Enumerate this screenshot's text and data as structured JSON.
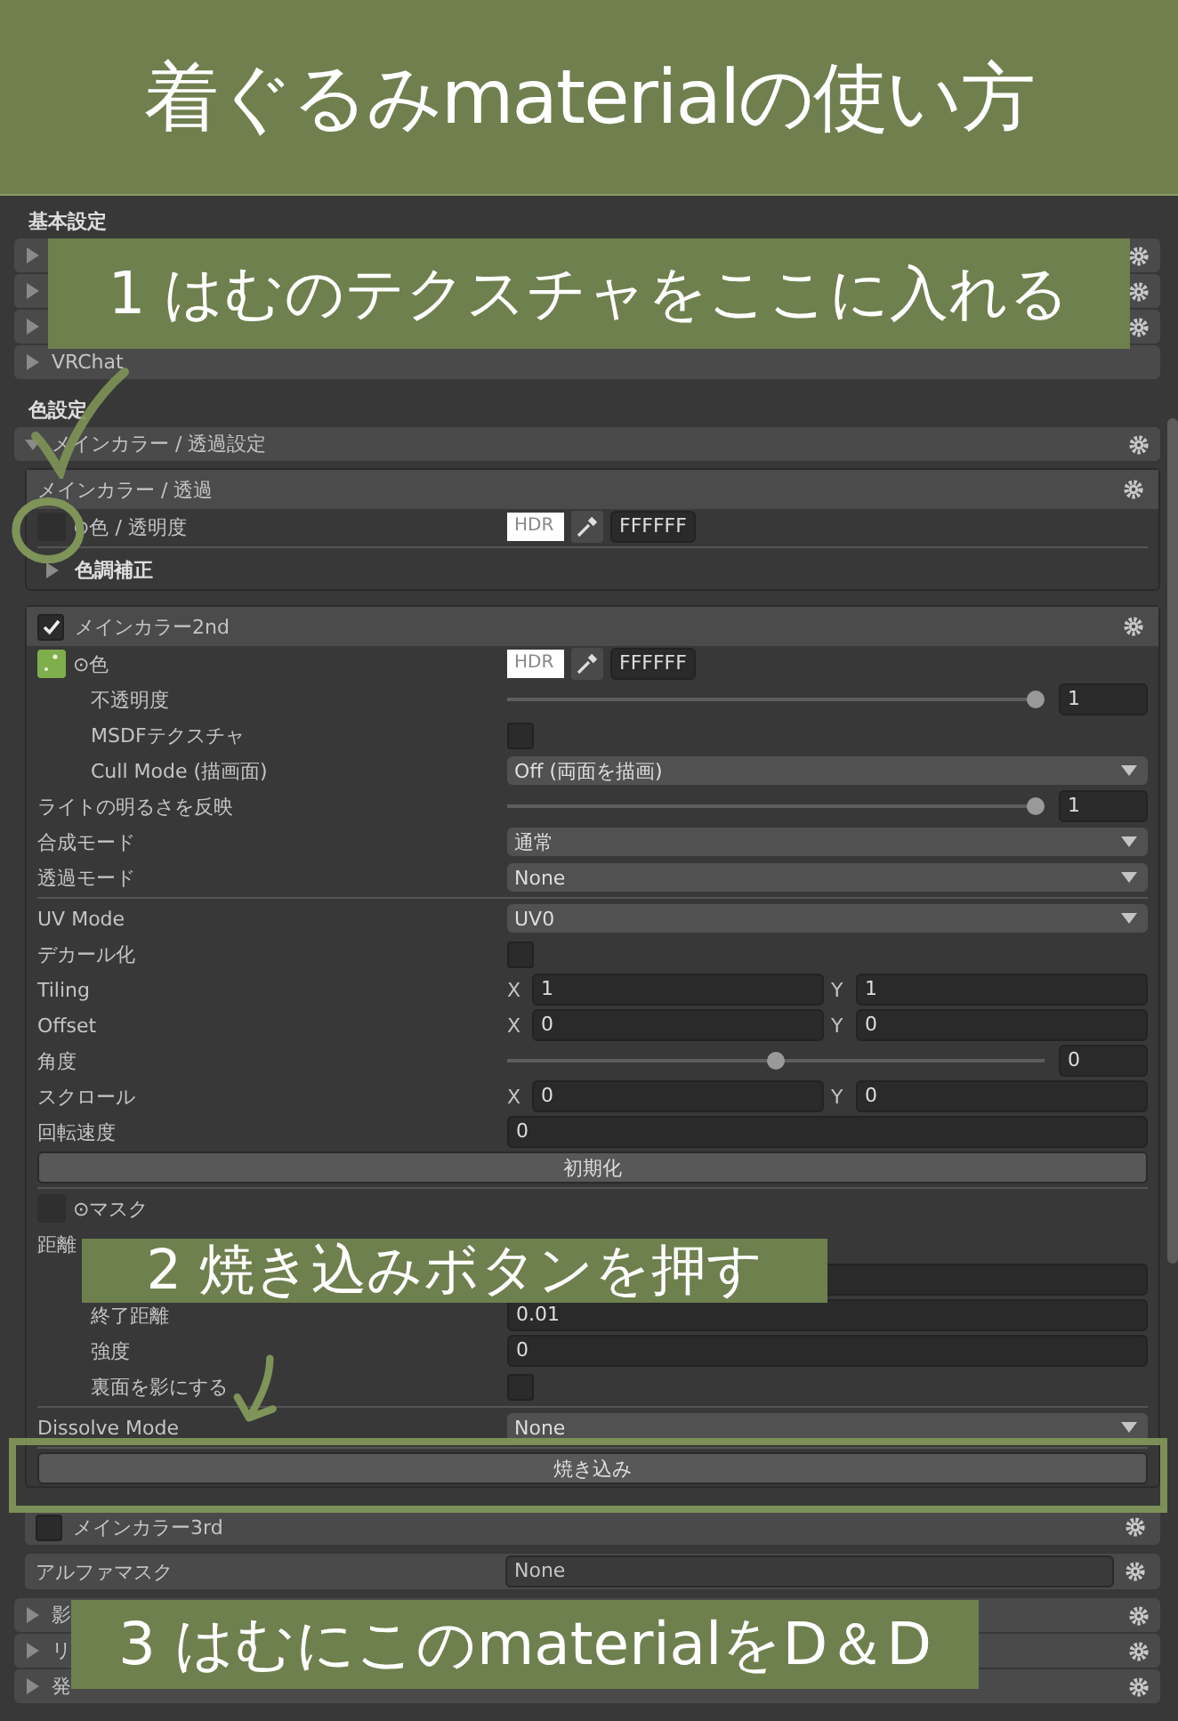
{
  "banner": {
    "title": "着ぐるみmaterialの使い方"
  },
  "groups": [
    {
      "title": "基本設定",
      "foldouts": [
        {
          "expanded": false,
          "gear": true
        },
        {
          "expanded": false,
          "gear": true
        },
        {
          "expanded": false,
          "gear": true
        },
        {
          "label": "VRChat",
          "expanded": false,
          "gear": false
        }
      ]
    },
    {
      "title": "色設定",
      "foldouts": [
        {
          "label": "メインカラー / 透過設定",
          "expanded": true,
          "gear": true
        }
      ]
    }
  ],
  "main_color": {
    "title": "メインカラー / 透過",
    "color_label": "⊙色 / 透明度",
    "texture_set": false,
    "hdr": "HDR",
    "hex": "FFFFFF",
    "subsection": {
      "label": "色調補正",
      "expanded": false
    }
  },
  "main_color_2nd": {
    "title": "メインカラー2nd",
    "checked": true,
    "rows": [
      {
        "kind": "color",
        "label": "⊙色",
        "texture_set": true,
        "hdr": "HDR",
        "hex": "FFFFFF",
        "children": [
          {
            "kind": "slider",
            "label": "不透明度",
            "level": 1,
            "value": "1"
          },
          {
            "kind": "toggle",
            "label": "MSDFテクスチャ",
            "checked": false
          },
          {
            "kind": "dropdown",
            "label": "Cull Mode (描画面)",
            "value": "Off (両面を描画)"
          }
        ]
      },
      {
        "kind": "slider",
        "label": "ライトの明るさを反映",
        "level": 1,
        "value": "1"
      },
      {
        "kind": "dropdown",
        "label": "合成モード",
        "value": "通常"
      },
      {
        "kind": "dropdown",
        "label": "透過モード",
        "value": "None"
      },
      {
        "kind": "divider"
      },
      {
        "kind": "dropdown",
        "label": "UV Mode",
        "value": "UV0"
      },
      {
        "kind": "toggle",
        "label": "デカール化",
        "checked": false
      },
      {
        "kind": "vector",
        "label": "Tiling",
        "fields": [
          {
            "axis": "X",
            "value": "1"
          },
          {
            "axis": "Y",
            "value": "1"
          }
        ]
      },
      {
        "kind": "vector",
        "label": "Offset",
        "fields": [
          {
            "axis": "X",
            "value": "0"
          },
          {
            "axis": "Y",
            "value": "0"
          }
        ]
      },
      {
        "kind": "slider",
        "label": "角度",
        "level": 0.5,
        "value": "0"
      },
      {
        "kind": "vector",
        "label": "スクロール",
        "fields": [
          {
            "axis": "X",
            "value": "0"
          },
          {
            "axis": "Y",
            "value": "0"
          }
        ]
      },
      {
        "kind": "number",
        "label": "回転速度",
        "value": "0"
      },
      {
        "kind": "button",
        "label": "初期化"
      },
      {
        "kind": "divider"
      },
      {
        "kind": "texture",
        "label": "⊙マスク",
        "texture_set": false
      },
      {
        "kind": "header",
        "label": "距離",
        "children": [
          {
            "kind": "number"
          },
          {
            "kind": "number",
            "label": "終了距離",
            "value": "0.01"
          },
          {
            "kind": "number",
            "label": "強度",
            "value": "0"
          },
          {
            "kind": "toggle",
            "label": "裏面を影にする",
            "checked": false
          }
        ]
      },
      {
        "kind": "divider"
      },
      {
        "kind": "dropdown",
        "label": "Dissolve Mode",
        "value": "None"
      },
      {
        "kind": "divider"
      },
      {
        "kind": "button",
        "label": "焼き込み"
      }
    ]
  },
  "main_color_3rd": {
    "title": "メインカラー3rd",
    "checked": false
  },
  "alpha_mask": {
    "label": "アルファマスク",
    "value": "None"
  },
  "more_foldouts": [
    {
      "label": "影",
      "expanded": false
    },
    {
      "label": "リ",
      "expanded": false
    },
    {
      "label": "発",
      "expanded": false
    }
  ],
  "annotations": [
    {
      "kind": "caption",
      "text": "1 はむのテクスチャをここに入れる"
    },
    {
      "kind": "check"
    },
    {
      "kind": "circle"
    },
    {
      "kind": "caption",
      "text": "2 焼き込みボタンを押す"
    },
    {
      "kind": "arrow"
    },
    {
      "kind": "frame"
    },
    {
      "kind": "caption",
      "text": "3 はむにこのmaterialをD＆D"
    }
  ]
}
